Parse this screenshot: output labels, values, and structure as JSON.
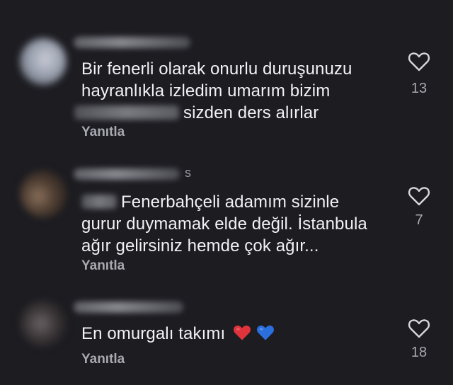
{
  "comments": [
    {
      "lines": [
        "Bir fenerli olarak onurlu duruşunuzu",
        "hayranlıkla izledim umarım bizim",
        "sizden ders alırlar"
      ],
      "reply_label": "Yanıtla",
      "likes": "13"
    },
    {
      "name_suffix": "s",
      "lines": [
        "Fenerbahçeli adamım sizinle",
        "gurur duymamak elde değil. İstanbula",
        "ağır gelirsiniz hemde çok ağır..."
      ],
      "reply_label": "Yanıtla",
      "likes": "7"
    },
    {
      "lines": [
        "En omurgalı takımı"
      ],
      "emojis": [
        "red-heart",
        "blue-heart"
      ],
      "reply_label": "Yanıtla",
      "likes": "18"
    }
  ],
  "colors": {
    "background": "#1c1c21",
    "text": "#f2f2f4",
    "secondary": "#a8a8b0",
    "heart_red": "#e0343c",
    "heart_blue": "#2b6fdc"
  }
}
